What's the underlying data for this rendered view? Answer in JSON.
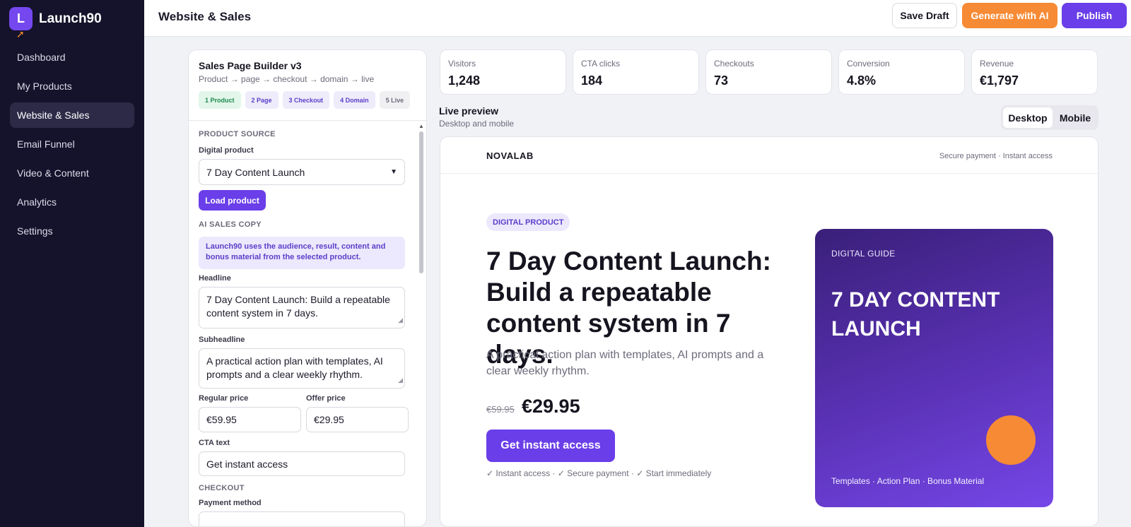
{
  "app": {
    "name": "Launch90",
    "logo_letter": "L",
    "logo_arrow_icon": "arrow-up-right-icon"
  },
  "nav": [
    {
      "label": "Dashboard",
      "active": false
    },
    {
      "label": "My Products",
      "active": false
    },
    {
      "label": "Website & Sales",
      "active": true
    },
    {
      "label": "Email Funnel",
      "active": false
    },
    {
      "label": "Video & Content",
      "active": false
    },
    {
      "label": "Analytics",
      "active": false
    },
    {
      "label": "Settings",
      "active": false
    }
  ],
  "header": {
    "title": "Website & Sales",
    "save_draft": "Save Draft",
    "generate_ai": "Generate with AI",
    "publish": "Publish"
  },
  "builder": {
    "title": "Sales Page Builder v3",
    "subtitle": "Product → page → checkout → domain → live",
    "steps": [
      "1 Product",
      "2 Page",
      "3 Checkout",
      "4 Domain",
      "5 Live"
    ],
    "product_source": {
      "section": "PRODUCT SOURCE",
      "label": "Digital product",
      "selected": "7 Day Content Launch",
      "load_button": "Load product"
    },
    "ai_copy": {
      "section": "AI SALES COPY",
      "info": "Launch90 uses the audience, result, content and bonus material from the selected product.",
      "headline_label": "Headline",
      "headline_value": "7 Day Content Launch: Build a repeatable content system in 7 days.",
      "subheadline_label": "Subheadline",
      "subheadline_value": "A practical action plan with templates, AI prompts and a clear weekly rhythm.",
      "regular_price_label": "Regular price",
      "regular_price_value": "€59.95",
      "offer_price_label": "Offer price",
      "offer_price_value": "€29.95",
      "cta_label": "CTA text",
      "cta_value": "Get instant access"
    },
    "checkout": {
      "section": "CHECKOUT",
      "payment_label": "Payment method"
    }
  },
  "stats": [
    {
      "label": "Visitors",
      "value": "1,248"
    },
    {
      "label": "CTA clicks",
      "value": "184"
    },
    {
      "label": "Checkouts",
      "value": "73"
    },
    {
      "label": "Conversion",
      "value": "4.8%"
    },
    {
      "label": "Revenue",
      "value": "€1,797"
    }
  ],
  "preview": {
    "title": "Live preview",
    "subtitle": "Desktop and mobile",
    "toggle_desktop": "Desktop",
    "toggle_mobile": "Mobile",
    "active_view": "Desktop",
    "page": {
      "brand": "NOVALAB",
      "secure": "Secure payment · Instant access",
      "badge": "DIGITAL PRODUCT",
      "headline": "7 Day Content Launch: Build a repeatable content system in 7 days.",
      "subheadline": "A practical action plan with templates, AI prompts and a clear weekly rhythm.",
      "old_price": "€59.95",
      "new_price": "€29.95",
      "cta": "Get instant access",
      "trust": "✓ Instant access · ✓ Secure payment · ✓ Start immediately",
      "cover": {
        "kicker": "DIGITAL GUIDE",
        "title": "7 DAY CONTENT LAUNCH",
        "footer": "Templates · Action Plan · Bonus Material"
      }
    }
  },
  "colors": {
    "sidebar_bg": "#15132b",
    "accent_purple": "#6a3ee8",
    "accent_orange": "#f78a34",
    "success_green": "#1d8a4d"
  }
}
